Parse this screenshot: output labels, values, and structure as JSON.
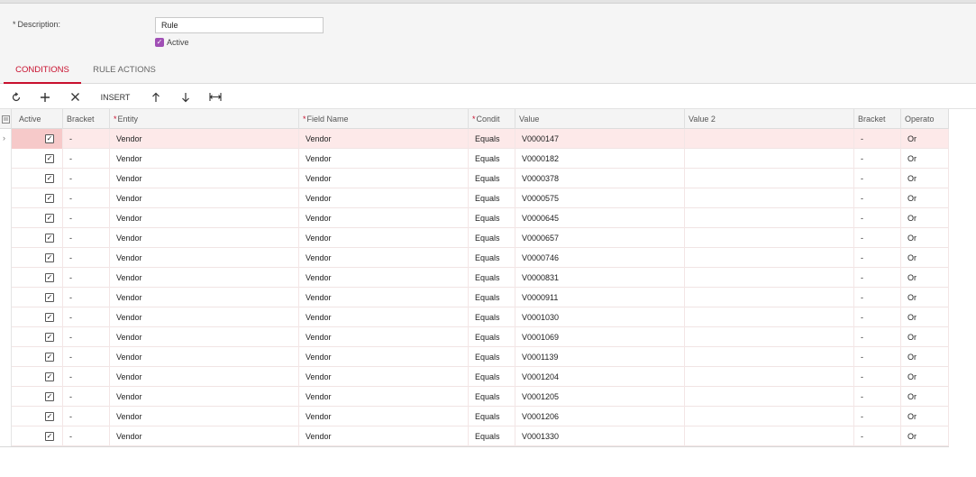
{
  "form": {
    "description_label": "Description:",
    "description_required": "*",
    "description_value": "Rule",
    "active_label": "Active",
    "active_checked": true
  },
  "tabs": [
    {
      "label": "CONDITIONS",
      "active": true
    },
    {
      "label": "RULE ACTIONS",
      "active": false
    }
  ],
  "toolbar": {
    "refresh_icon": "refresh-icon",
    "add_icon": "plus-icon",
    "delete_icon": "close-icon",
    "insert_label": "INSERT",
    "up_icon": "arrow-up-icon",
    "down_icon": "arrow-down-icon",
    "fit_icon": "fit-columns-icon"
  },
  "grid": {
    "columns": {
      "active": "Active",
      "bracket_open": "Bracket",
      "entity": "Entity",
      "field_name": "Field Name",
      "condition": "Condit",
      "value": "Value",
      "value2": "Value 2",
      "bracket_close": "Bracket",
      "operator": "Operato"
    },
    "required_mark": "*",
    "rows": [
      {
        "active": true,
        "br1": "-",
        "entity": "Vendor",
        "field": "Vendor",
        "cond": "Equals",
        "value": "V0000147",
        "value2": "",
        "br2": "-",
        "op": "Or"
      },
      {
        "active": true,
        "br1": "-",
        "entity": "Vendor",
        "field": "Vendor",
        "cond": "Equals",
        "value": "V0000182",
        "value2": "",
        "br2": "-",
        "op": "Or"
      },
      {
        "active": true,
        "br1": "-",
        "entity": "Vendor",
        "field": "Vendor",
        "cond": "Equals",
        "value": "V0000378",
        "value2": "",
        "br2": "-",
        "op": "Or"
      },
      {
        "active": true,
        "br1": "-",
        "entity": "Vendor",
        "field": "Vendor",
        "cond": "Equals",
        "value": "V0000575",
        "value2": "",
        "br2": "-",
        "op": "Or"
      },
      {
        "active": true,
        "br1": "-",
        "entity": "Vendor",
        "field": "Vendor",
        "cond": "Equals",
        "value": "V0000645",
        "value2": "",
        "br2": "-",
        "op": "Or"
      },
      {
        "active": true,
        "br1": "-",
        "entity": "Vendor",
        "field": "Vendor",
        "cond": "Equals",
        "value": "V0000657",
        "value2": "",
        "br2": "-",
        "op": "Or"
      },
      {
        "active": true,
        "br1": "-",
        "entity": "Vendor",
        "field": "Vendor",
        "cond": "Equals",
        "value": "V0000746",
        "value2": "",
        "br2": "-",
        "op": "Or"
      },
      {
        "active": true,
        "br1": "-",
        "entity": "Vendor",
        "field": "Vendor",
        "cond": "Equals",
        "value": "V0000831",
        "value2": "",
        "br2": "-",
        "op": "Or"
      },
      {
        "active": true,
        "br1": "-",
        "entity": "Vendor",
        "field": "Vendor",
        "cond": "Equals",
        "value": "V0000911",
        "value2": "",
        "br2": "-",
        "op": "Or"
      },
      {
        "active": true,
        "br1": "-",
        "entity": "Vendor",
        "field": "Vendor",
        "cond": "Equals",
        "value": "V0001030",
        "value2": "",
        "br2": "-",
        "op": "Or"
      },
      {
        "active": true,
        "br1": "-",
        "entity": "Vendor",
        "field": "Vendor",
        "cond": "Equals",
        "value": "V0001069",
        "value2": "",
        "br2": "-",
        "op": "Or"
      },
      {
        "active": true,
        "br1": "-",
        "entity": "Vendor",
        "field": "Vendor",
        "cond": "Equals",
        "value": "V0001139",
        "value2": "",
        "br2": "-",
        "op": "Or"
      },
      {
        "active": true,
        "br1": "-",
        "entity": "Vendor",
        "field": "Vendor",
        "cond": "Equals",
        "value": "V0001204",
        "value2": "",
        "br2": "-",
        "op": "Or"
      },
      {
        "active": true,
        "br1": "-",
        "entity": "Vendor",
        "field": "Vendor",
        "cond": "Equals",
        "value": "V0001205",
        "value2": "",
        "br2": "-",
        "op": "Or"
      },
      {
        "active": true,
        "br1": "-",
        "entity": "Vendor",
        "field": "Vendor",
        "cond": "Equals",
        "value": "V0001206",
        "value2": "",
        "br2": "-",
        "op": "Or"
      },
      {
        "active": true,
        "br1": "-",
        "entity": "Vendor",
        "field": "Vendor",
        "cond": "Equals",
        "value": "V0001330",
        "value2": "",
        "br2": "-",
        "op": "Or"
      }
    ]
  },
  "colors": {
    "accent": "#c8102e",
    "checkbox_active": "#a04fb5",
    "selected_row": "#fde9e9"
  }
}
